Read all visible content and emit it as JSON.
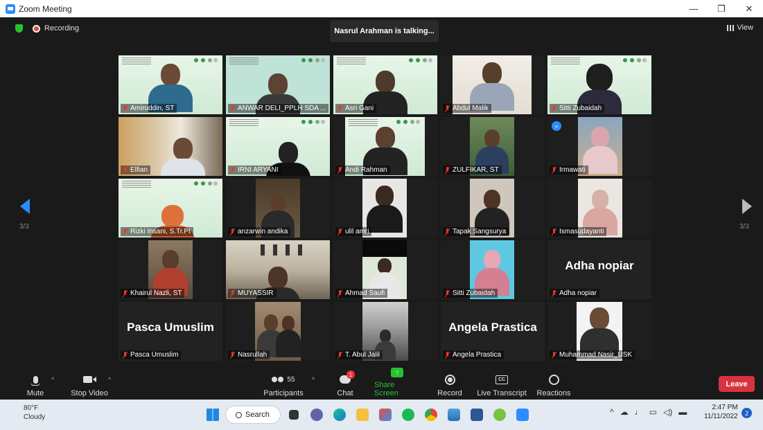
{
  "window": {
    "title": "Zoom Meeting",
    "minimize": "—",
    "restore": "❐",
    "close": "✕"
  },
  "meeting": {
    "recording_label": "Recording",
    "talking": "Nasrul Arahman is talking...",
    "view_label": "View",
    "page_left": "3/3",
    "page_right": "3/3"
  },
  "participants": [
    {
      "name": "Amiruddin, ST"
    },
    {
      "name": "ANWAR DELI_PPLH SDA ..."
    },
    {
      "name": "Asri Gani"
    },
    {
      "name": "Abdul Malik"
    },
    {
      "name": "Sitti Zubaidah"
    },
    {
      "name": "Elfian"
    },
    {
      "name": "IRNI ARYANI"
    },
    {
      "name": "Andi Rahman"
    },
    {
      "name": "ZULFIKAR, ST"
    },
    {
      "name": "Irmawati"
    },
    {
      "name": "Rizki Insani, S.Tr.Pt"
    },
    {
      "name": "anzarwin andika"
    },
    {
      "name": "ulil amri"
    },
    {
      "name": "Tapak Sangsurya"
    },
    {
      "name": "Ismasudayanti"
    },
    {
      "name": "Khairul Nazli, ST"
    },
    {
      "name": "MUYASSIR"
    },
    {
      "name": "Ahmad Saufi"
    },
    {
      "name": "Sitti Zubaidah"
    },
    {
      "name": "Adha nopiar",
      "display": "Adha nopiar"
    },
    {
      "name": "Pasca Umuslim",
      "display": "Pasca Umuslim"
    },
    {
      "name": "Nasrullah"
    },
    {
      "name": "T. Abul Jalil"
    },
    {
      "name": "Angela Prastica",
      "display": "Angela Prastica"
    },
    {
      "name": "Muhammad Nasir_USK"
    }
  ],
  "toolbar": {
    "mute": "Mute",
    "stop_video": "Stop Video",
    "participants": "Participants",
    "participants_count": "55",
    "chat": "Chat",
    "chat_badge": "1",
    "share": "Share Screen",
    "record": "Record",
    "transcript": "Live Transcript",
    "cc": "CC",
    "reactions": "Reactions",
    "leave": "Leave"
  },
  "taskbar": {
    "temp": "80°F",
    "weather": "Cloudy",
    "search": "Search",
    "time": "2:47 PM",
    "date": "11/11/2022",
    "notifications": "2"
  },
  "colors": {
    "accent": "#2D8CFF",
    "leave": "#d6333f",
    "share": "#27c22f"
  }
}
